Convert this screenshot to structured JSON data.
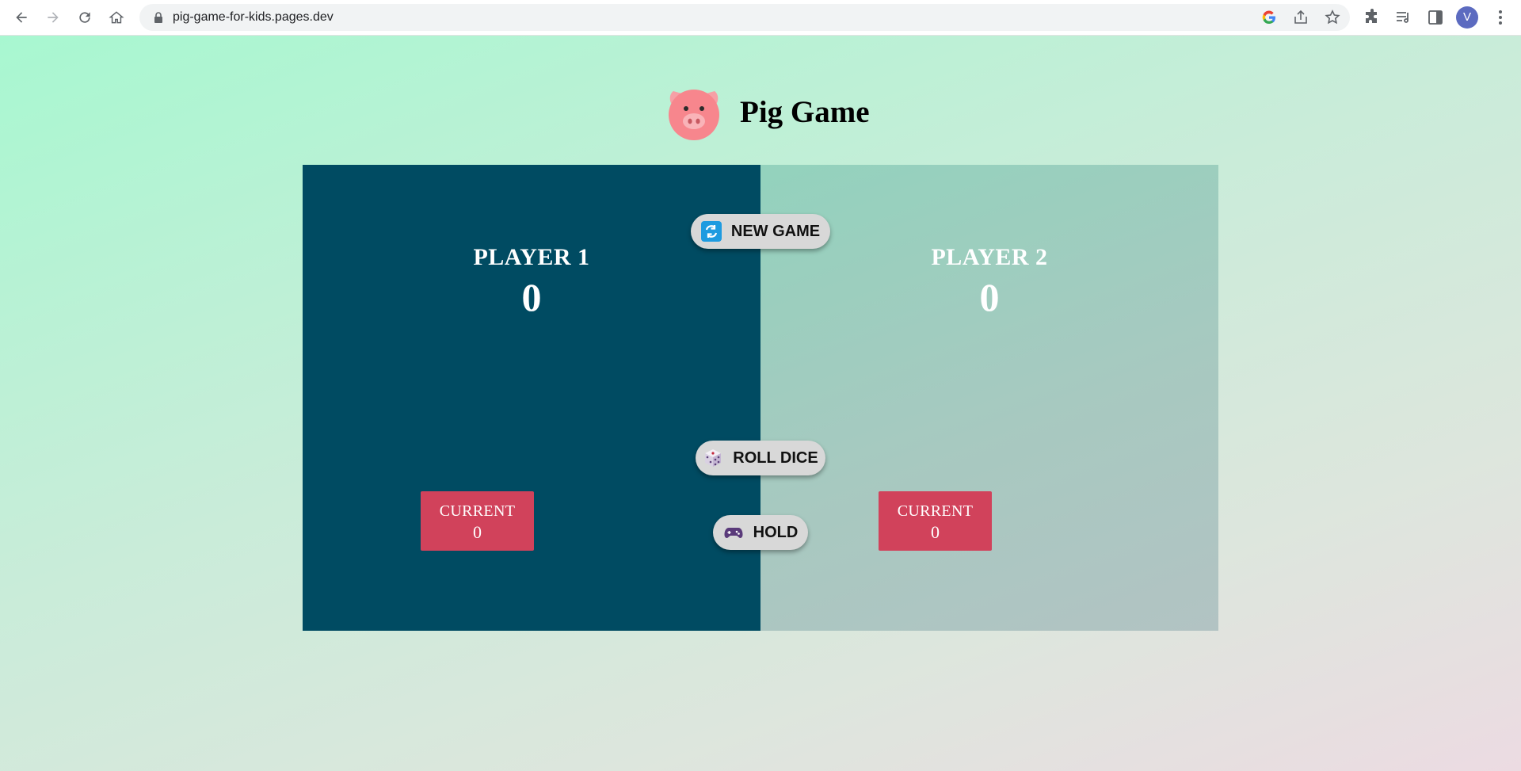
{
  "browser": {
    "url": "pig-game-for-kids.pages.dev",
    "profile_initial": "V",
    "icons": [
      "back-icon",
      "forward-icon",
      "reload-icon",
      "home-icon",
      "lock-icon",
      "google-icon",
      "share-icon",
      "star-icon",
      "extensions-icon",
      "reading-list-icon",
      "side-panel-icon",
      "menu-icon"
    ]
  },
  "header": {
    "title": "Pig Game",
    "logo_icon": "pig-face-icon"
  },
  "players": [
    {
      "name": "PLAYER 1",
      "score": "0",
      "current_label": "CURRENT",
      "current_value": "0",
      "active": true
    },
    {
      "name": "PLAYER 2",
      "score": "0",
      "current_label": "CURRENT",
      "current_value": "0",
      "active": false
    }
  ],
  "controls": {
    "new_game": {
      "label": "NEW GAME",
      "icon": "refresh-icon"
    },
    "roll_dice": {
      "label": "ROLL DICE",
      "icon": "dice-icon"
    },
    "hold": {
      "label": "HOLD",
      "icon": "gamepad-icon"
    }
  },
  "colors": {
    "active_panel": "#004b62",
    "inactive_panel": "#a7c9c0",
    "current_box": "#d1425b",
    "button_bg": "#d8d8d8"
  }
}
